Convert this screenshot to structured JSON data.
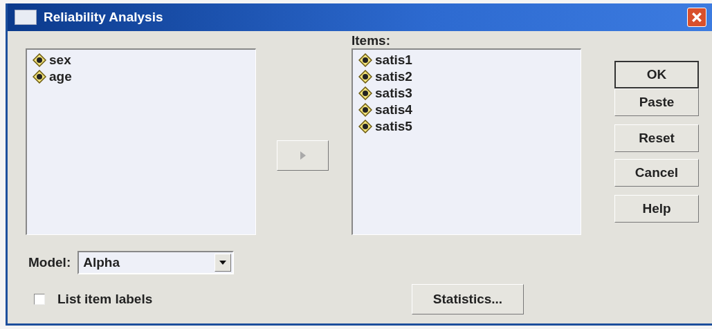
{
  "window": {
    "title": "Reliability Analysis"
  },
  "source_list": {
    "items": [
      {
        "label": "sex",
        "selected": false
      },
      {
        "label": "age",
        "selected": false
      }
    ]
  },
  "move_button": {
    "disabled": true
  },
  "items_list": {
    "label": "Items:",
    "items": [
      {
        "label": "satis1",
        "selected": false
      },
      {
        "label": "satis2",
        "selected": false
      },
      {
        "label": "satis3",
        "selected": false
      },
      {
        "label": "satis4",
        "selected": false
      },
      {
        "label": "satis5",
        "selected": false
      }
    ]
  },
  "buttons": [
    {
      "label": "OK",
      "default": true
    },
    {
      "label": "Paste",
      "default": false
    },
    {
      "label": "Reset",
      "default": false
    },
    {
      "label": "Cancel",
      "default": false
    },
    {
      "label": "Help",
      "default": false
    }
  ],
  "model": {
    "label": "Model:",
    "value": "Alpha"
  },
  "list_item_labels": {
    "label": "List item labels",
    "checked": false
  },
  "statistics_button": {
    "label": "Statistics..."
  }
}
